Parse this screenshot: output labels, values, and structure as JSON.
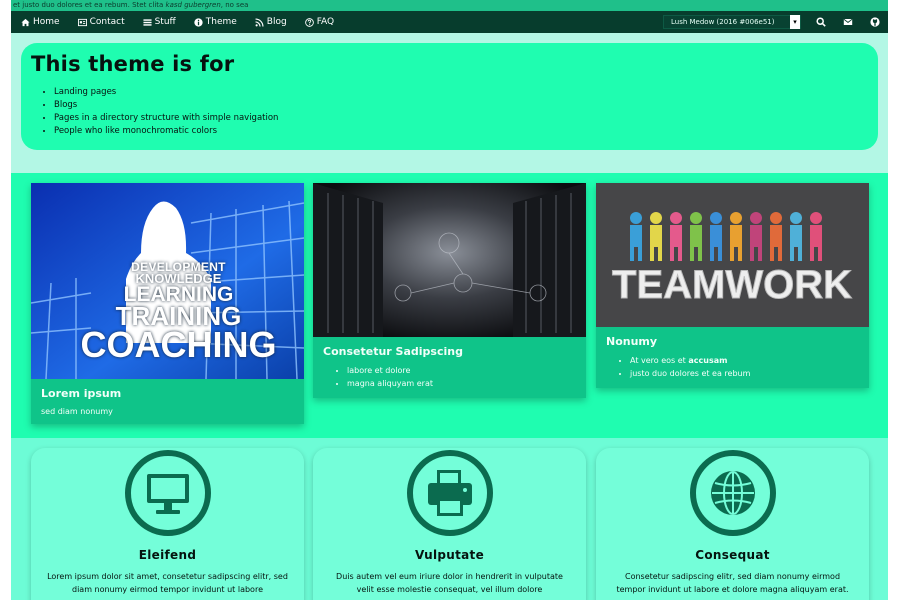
{
  "topstrip": {
    "before": "et justo duo dolores et ea rebum. Stet clita ",
    "italic": "kasd gubergren",
    "after": ", no sea"
  },
  "nav": {
    "items": [
      {
        "label": "Home"
      },
      {
        "label": "Contact"
      },
      {
        "label": "Stuff"
      },
      {
        "label": "Theme"
      },
      {
        "label": "Blog"
      },
      {
        "label": "FAQ"
      }
    ],
    "theme_select": "Lush Medow (2016 #006e51)"
  },
  "hero": {
    "title": "This theme is for",
    "bullets": [
      "Landing pages",
      "Blogs",
      "Pages in a directory structure with simple navigation",
      "People who like monochromatic colors"
    ]
  },
  "cards": [
    {
      "title": "Lorem ipsum",
      "text": "sed diam nonumy",
      "image_words": [
        "DEVELOPMENT",
        "KNOWLEDGE",
        "LEARNING",
        "TRAINING",
        "COACHING"
      ]
    },
    {
      "title": "Consetetur Sadipscing",
      "bullets": [
        "labore et dolore",
        "magna aliquyam erat"
      ]
    },
    {
      "title": "Nonumy",
      "bullet1_pre": "At vero eos et ",
      "bullet1_bold": "accusam",
      "bullet2": "justo duo dolores et ea rebum",
      "image_word": "TEAMWORK"
    }
  ],
  "features": [
    {
      "icon": "monitor-icon",
      "title": "Eleifend",
      "text": "Lorem ipsum dolor sit amet, consetetur sadipscing elitr, sed diam nonumy eirmod tempor invidunt ut labore"
    },
    {
      "icon": "printer-icon",
      "title": "Vulputate",
      "text": "Duis autem vel eum iriure dolor in hendrerit in vulputate velit esse molestie consequat, vel illum dolore"
    },
    {
      "icon": "globe-icon",
      "title": "Consequat",
      "text": "Consetetur sadipscing elitr, sed diam nonumy eirmod tempor invidunt ut labore et dolore magna aliquyam erat."
    }
  ],
  "colors": {
    "nav_bg": "#073d2d",
    "accent": "#1ffdb0",
    "card": "#0fc489",
    "icon": "#0b6b4f"
  }
}
